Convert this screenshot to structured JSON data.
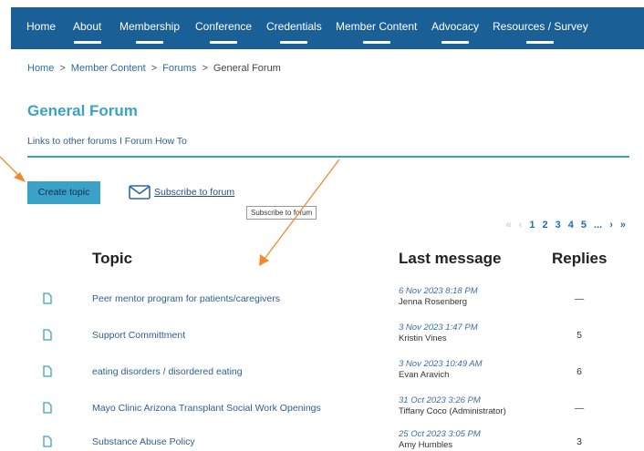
{
  "nav": [
    "Home",
    "About",
    "Membership",
    "Conference",
    "Credentials",
    "Member Content",
    "Advocacy",
    "Resources / Survey"
  ],
  "breadcrumb": [
    "Home",
    "Member Content",
    "Forums",
    "General Forum"
  ],
  "breadcrumb_sep": ">",
  "page_title": "General Forum",
  "subnav_text": "Links to other forums I Forum How To",
  "create_topic_label": "Create topic",
  "subscribe_label": "Subscribe to forum",
  "tooltip_text": "Subscribe to forum",
  "pager": {
    "first": "«",
    "prev": "‹",
    "pages": [
      "1",
      "2",
      "3",
      "4",
      "5"
    ],
    "ellipsis": "...",
    "next": "›",
    "last": "»"
  },
  "table": {
    "headers": {
      "topic": "Topic",
      "last_message": "Last message",
      "replies": "Replies"
    },
    "rows": [
      {
        "title": "Peer mentor program for patients/caregivers",
        "date": "6 Nov 2023 8:18 PM",
        "author": "Jenna Rosenberg",
        "replies": "—"
      },
      {
        "title": "Support Committment",
        "date": "3 Nov 2023 1:47 PM",
        "author": "Kristin Vines",
        "replies": "5"
      },
      {
        "title": "eating disorders / disordered eating",
        "date": "3 Nov 2023 10:49 AM",
        "author": "Evan Aravich",
        "replies": "6"
      },
      {
        "title": "Mayo Clinic Arizona Transplant Social Work Openings",
        "date": "31 Oct 2023 3:26 PM",
        "author": "Tiffany Coco (Administrator)",
        "replies": "—"
      },
      {
        "title": "Substance Abuse Policy",
        "date": "25 Oct 2023 3:05 PM",
        "author": "Amy Humbles",
        "replies": "3"
      }
    ]
  },
  "colors": {
    "nav_bg": "#1a5f96",
    "accent": "#3aa2c8",
    "annotation_arrow": "#f08a2c"
  }
}
